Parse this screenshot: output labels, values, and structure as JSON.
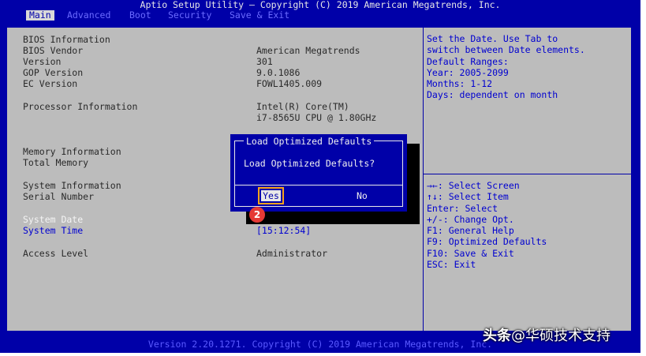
{
  "header": {
    "title": "Aptio Setup Utility – Copyright (C) 2019 American Megatrends, Inc."
  },
  "tabs": [
    {
      "label": "Main",
      "active": true
    },
    {
      "label": "Advanced",
      "active": false
    },
    {
      "label": "Boot",
      "active": false
    },
    {
      "label": "Security",
      "active": false
    },
    {
      "label": "Save & Exit",
      "active": false
    }
  ],
  "info": {
    "bios_information": "BIOS Information",
    "bios_vendor_label": "BIOS Vendor",
    "bios_vendor_value": "American Megatrends",
    "version_label": "Version",
    "version_value": "301",
    "gop_version_label": "GOP Version",
    "gop_version_value": "9.0.1086",
    "ec_version_label": "EC Version",
    "ec_version_value": "FOWL1405.009",
    "processor_label": "Processor Information",
    "processor_value_line1": "Intel(R) Core(TM)",
    "processor_value_line2": "i7-8565U CPU @ 1.80GHz",
    "memory_information": "Memory Information",
    "total_memory_label": "Total Memory",
    "system_information": "System Information",
    "serial_number_label": "Serial Number",
    "system_date_label": "System Date",
    "system_time_label": "System Time",
    "system_time_value": "[15:12:54]",
    "access_level_label": "Access Level",
    "access_level_value": "Administrator"
  },
  "help": {
    "description": [
      "Set the Date. Use Tab to",
      "switch between Date elements.",
      "Default Ranges:",
      "Year: 2005-2099",
      "Months: 1-12",
      "Days: dependent on month"
    ],
    "keys": [
      "→←: Select Screen",
      "↑↓: Select Item",
      "Enter: Select",
      "+/-: Change Opt.",
      "F1: General Help",
      "F9: Optimized Defaults",
      "F10: Save & Exit",
      "ESC: Exit"
    ]
  },
  "dialog": {
    "title": "Load Optimized Defaults",
    "message": "Load Optimized Defaults?",
    "yes_label": "Yes",
    "no_label": "No"
  },
  "annotation": {
    "step_number": "2"
  },
  "footer": {
    "text": "Version 2.20.1271. Copyright (C) 2019 American Megatrends, Inc."
  },
  "watermark": {
    "brand": "头条",
    "handle": "@华硕技术支持"
  },
  "colors": {
    "bios_blue": "#0000a8",
    "panel_gray": "#bcbcbc",
    "highlight_orange": "#f5a21c",
    "badge_red": "#e53935"
  }
}
